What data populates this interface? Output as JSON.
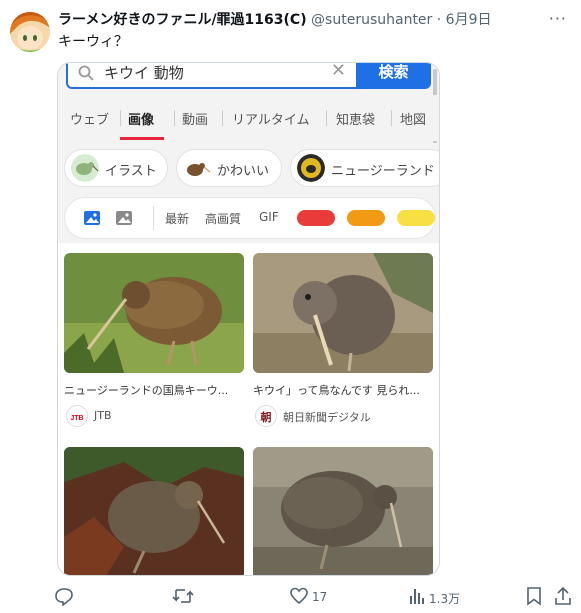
{
  "tweet": {
    "display_name": "ラーメン好きのファニル/罪過1163(C)",
    "handle": "@suterusuhanter",
    "separator": "·",
    "date": "6月9日",
    "text": "キーウィ？",
    "more_label": "···"
  },
  "embedded": {
    "search": {
      "query": "キウイ 動物",
      "clear_label": "✕",
      "button_label": "検索"
    },
    "tabs": [
      {
        "label": "ウェブ"
      },
      {
        "label": "画像"
      },
      {
        "label": "動画"
      },
      {
        "label": "リアルタイム"
      },
      {
        "label": "知恵袋"
      },
      {
        "label": "地図"
      }
    ],
    "chips": [
      {
        "label": "イラスト",
        "icon": "kiwi-illustration-icon"
      },
      {
        "label": "かわいい",
        "icon": "cute-kiwi-icon"
      },
      {
        "label": "ニュージーランド",
        "icon": "new-zealand-emblem-icon"
      }
    ],
    "filters": {
      "latest": "最新",
      "hq": "高画質",
      "gif": "GIF",
      "colors": [
        "#ea3b3b",
        "#f39a14",
        "#f8e044"
      ]
    },
    "results": [
      {
        "caption": "ニュージーランドの国鳥キーウ...",
        "source": "JTB",
        "logo_text": "JTB",
        "logo_color": "#d6001c"
      },
      {
        "caption": "キウイ」って鳥なんです 見られ...",
        "source": "朝日新聞デジタル",
        "logo_text": "朝",
        "logo_color": "#8a1a1a"
      },
      {
        "caption": "",
        "source": ""
      },
      {
        "caption": "",
        "source": ""
      }
    ]
  },
  "actions": {
    "reply_count": "",
    "retweet_count": "",
    "like_count": "17",
    "views_count": "1.3万"
  }
}
